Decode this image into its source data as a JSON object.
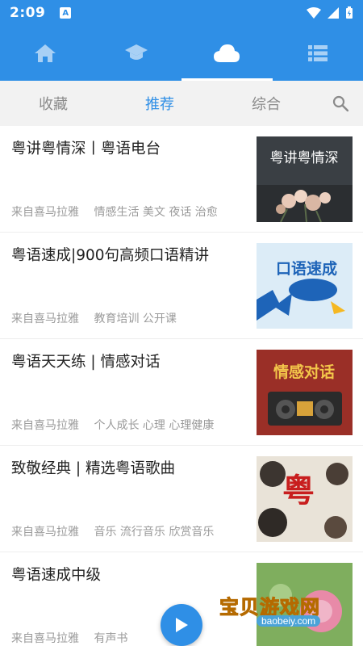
{
  "status": {
    "time": "2:09",
    "app_badge": "A"
  },
  "topnav": {
    "items": [
      {
        "icon": "home-icon"
      },
      {
        "icon": "graduation-cap-icon"
      },
      {
        "icon": "cloud-icon",
        "active": true
      },
      {
        "icon": "list-icon"
      }
    ]
  },
  "tabs": [
    {
      "label": "收藏"
    },
    {
      "label": "推荐",
      "active": true
    },
    {
      "label": "综合"
    }
  ],
  "items": [
    {
      "title": "粤讲粤情深丨粤语电台",
      "source": "来自喜马拉雅",
      "tags": "情感生活 美文 夜话 治愈",
      "thumb_text": "粤讲粤情深"
    },
    {
      "title": "粤语速成|900句高频口语精讲",
      "source": "来自喜马拉雅",
      "tags": "教育培训 公开课",
      "thumb_text": "口语速成"
    },
    {
      "title": "粤语天天练 | 情感对话",
      "source": "来自喜马拉雅",
      "tags": "个人成长 心理 心理健康",
      "thumb_text": "情感对话"
    },
    {
      "title": "致敬经典 | 精选粤语歌曲",
      "source": "来自喜马拉雅",
      "tags": "音乐 流行音乐 欣赏音乐",
      "thumb_text": "粤"
    },
    {
      "title": "粤语速成中级",
      "source": "来自喜马拉雅",
      "tags": "有声书",
      "thumb_text": ""
    }
  ],
  "watermark": {
    "text": "宝贝游戏网",
    "sub": "baobeiy.com"
  },
  "colors": {
    "primary": "#2f8fe6",
    "tab_bg": "#f2f2f2"
  }
}
